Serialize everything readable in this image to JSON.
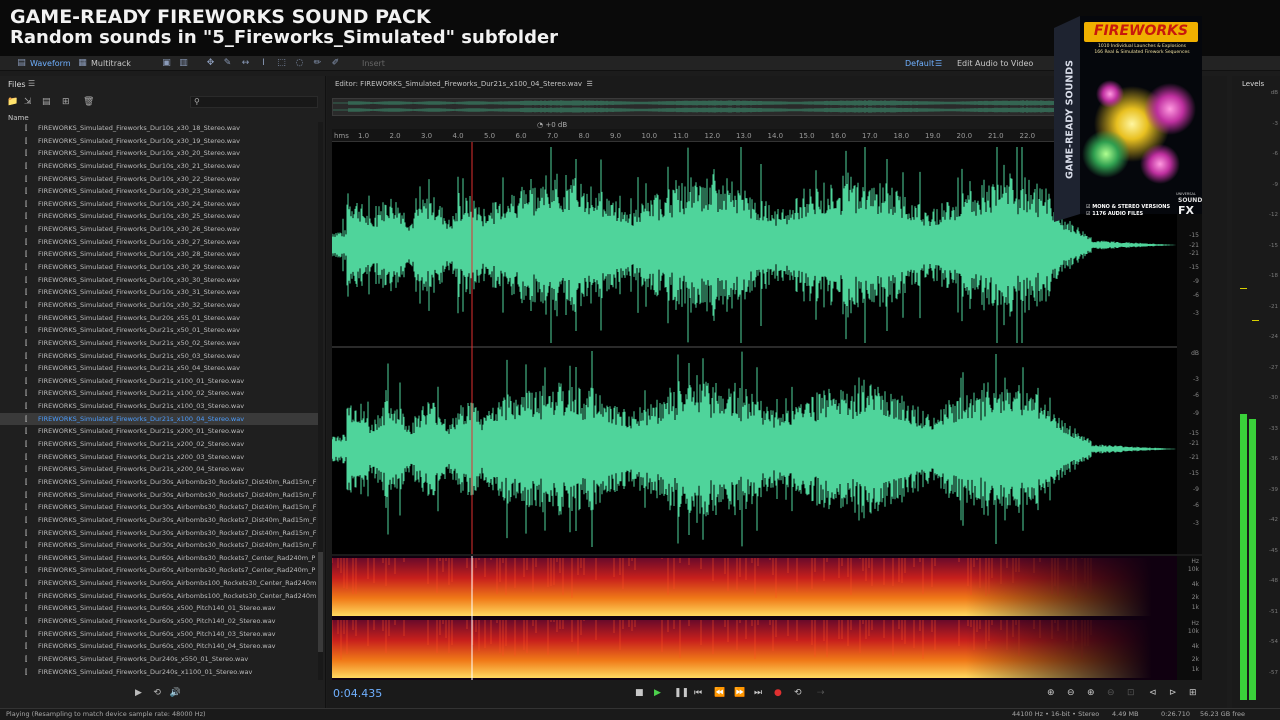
{
  "banner": {
    "line1": "GAME-READY FIREWORKS SOUND PACK",
    "line2": "Random sounds in \"5_Fireworks_Simulated\" subfolder"
  },
  "toolbar": {
    "waveform": "Waveform",
    "multitrack": "Multitrack",
    "insert": "Insert",
    "workspace": "Default",
    "edit_video": "Edit Audio to Video"
  },
  "files_panel": {
    "title": "Files",
    "column_name": "Name",
    "items": [
      "FIREWORKS_Simulated_Fireworks_Dur10s_x30_18_Stereo.wav",
      "FIREWORKS_Simulated_Fireworks_Dur10s_x30_19_Stereo.wav",
      "FIREWORKS_Simulated_Fireworks_Dur10s_x30_20_Stereo.wav",
      "FIREWORKS_Simulated_Fireworks_Dur10s_x30_21_Stereo.wav",
      "FIREWORKS_Simulated_Fireworks_Dur10s_x30_22_Stereo.wav",
      "FIREWORKS_Simulated_Fireworks_Dur10s_x30_23_Stereo.wav",
      "FIREWORKS_Simulated_Fireworks_Dur10s_x30_24_Stereo.wav",
      "FIREWORKS_Simulated_Fireworks_Dur10s_x30_25_Stereo.wav",
      "FIREWORKS_Simulated_Fireworks_Dur10s_x30_26_Stereo.wav",
      "FIREWORKS_Simulated_Fireworks_Dur10s_x30_27_Stereo.wav",
      "FIREWORKS_Simulated_Fireworks_Dur10s_x30_28_Stereo.wav",
      "FIREWORKS_Simulated_Fireworks_Dur10s_x30_29_Stereo.wav",
      "FIREWORKS_Simulated_Fireworks_Dur10s_x30_30_Stereo.wav",
      "FIREWORKS_Simulated_Fireworks_Dur10s_x30_31_Stereo.wav",
      "FIREWORKS_Simulated_Fireworks_Dur10s_x30_32_Stereo.wav",
      "FIREWORKS_Simulated_Fireworks_Dur20s_x55_01_Stereo.wav",
      "FIREWORKS_Simulated_Fireworks_Dur21s_x50_01_Stereo.wav",
      "FIREWORKS_Simulated_Fireworks_Dur21s_x50_02_Stereo.wav",
      "FIREWORKS_Simulated_Fireworks_Dur21s_x50_03_Stereo.wav",
      "FIREWORKS_Simulated_Fireworks_Dur21s_x50_04_Stereo.wav",
      "FIREWORKS_Simulated_Fireworks_Dur21s_x100_01_Stereo.wav",
      "FIREWORKS_Simulated_Fireworks_Dur21s_x100_02_Stereo.wav",
      "FIREWORKS_Simulated_Fireworks_Dur21s_x100_03_Stereo.wav",
      "FIREWORKS_Simulated_Fireworks_Dur21s_x100_04_Stereo.wav",
      "FIREWORKS_Simulated_Fireworks_Dur21s_x200_01_Stereo.wav",
      "FIREWORKS_Simulated_Fireworks_Dur21s_x200_02_Stereo.wav",
      "FIREWORKS_Simulated_Fireworks_Dur21s_x200_03_Stereo.wav",
      "FIREWORKS_Simulated_Fireworks_Dur21s_x200_04_Stereo.wav",
      "FIREWORKS_Simulated_Fireworks_Dur30s_Airbombs30_Rockets7_Dist40m_Rad15m_F",
      "FIREWORKS_Simulated_Fireworks_Dur30s_Airbombs30_Rockets7_Dist40m_Rad15m_F",
      "FIREWORKS_Simulated_Fireworks_Dur30s_Airbombs30_Rockets7_Dist40m_Rad15m_F",
      "FIREWORKS_Simulated_Fireworks_Dur30s_Airbombs30_Rockets7_Dist40m_Rad15m_F",
      "FIREWORKS_Simulated_Fireworks_Dur30s_Airbombs30_Rockets7_Dist40m_Rad15m_F",
      "FIREWORKS_Simulated_Fireworks_Dur30s_Airbombs30_Rockets7_Dist40m_Rad15m_F",
      "FIREWORKS_Simulated_Fireworks_Dur60s_Airbombs30_Rockets7_Center_Rad240m_P",
      "FIREWORKS_Simulated_Fireworks_Dur60s_Airbombs30_Rockets7_Center_Rad240m_P",
      "FIREWORKS_Simulated_Fireworks_Dur60s_Airbombs100_Rockets30_Center_Rad240m",
      "FIREWORKS_Simulated_Fireworks_Dur60s_Airbombs100_Rockets30_Center_Rad240m",
      "FIREWORKS_Simulated_Fireworks_Dur60s_x500_Pitch140_01_Stereo.wav",
      "FIREWORKS_Simulated_Fireworks_Dur60s_x500_Pitch140_02_Stereo.wav",
      "FIREWORKS_Simulated_Fireworks_Dur60s_x500_Pitch140_03_Stereo.wav",
      "FIREWORKS_Simulated_Fireworks_Dur60s_x500_Pitch140_04_Stereo.wav",
      "FIREWORKS_Simulated_Fireworks_Dur240s_x550_01_Stereo.wav",
      "FIREWORKS_Simulated_Fireworks_Dur240s_x1100_01_Stereo.wav"
    ],
    "selected_index": 23
  },
  "editor": {
    "title": "Editor: FIREWORKS_Simulated_Fireworks_Dur21s_x100_04_Stereo.wav",
    "gain": "+0 dB",
    "time": "0:04.435",
    "ruler_unit": "hms",
    "ruler_ticks": [
      "1.0",
      "2.0",
      "3.0",
      "4.0",
      "5.0",
      "6.0",
      "7.0",
      "8.0",
      "9.0",
      "10.0",
      "11.0",
      "12.0",
      "13.0",
      "14.0",
      "15.0",
      "16.0",
      "17.0",
      "18.0",
      "19.0",
      "20.0",
      "21.0",
      "22.0"
    ],
    "db_ticks_top": [
      "-3",
      "-6",
      "-9",
      "-15",
      "-21",
      "-21",
      "-15",
      "-9",
      "-6",
      "-3"
    ],
    "db_label": "dB",
    "db_ticks_bottom": [
      "-3",
      "-6",
      "-9",
      "-15",
      "-21",
      "-21",
      "-15",
      "-9",
      "-6",
      "-3"
    ],
    "hz_label": "Hz",
    "hz_ticks": [
      "10k",
      "4k",
      "2k",
      "1k"
    ],
    "colors": {
      "wave": "#4fd49b",
      "playhead": "#e03030",
      "accent": "#4b9dff"
    }
  },
  "levels": {
    "title": "Levels",
    "ticks": [
      "dB",
      "-3",
      "-6",
      "-9",
      "-12",
      "-15",
      "-18",
      "-21",
      "-24",
      "-27",
      "-30",
      "-33",
      "-36",
      "-39",
      "-42",
      "-45",
      "-48",
      "-51",
      "-54",
      "-57"
    ]
  },
  "status": {
    "left": "Playing (Resampling to match device sample rate: 48000 Hz)",
    "format": "44100 Hz • 16-bit • Stereo",
    "size": "4.49 MB",
    "duration": "0:26.710",
    "free": "56.23 GB free"
  },
  "product": {
    "brand": "FIREWORKS",
    "line1": "1010 Individual Launches & Explosions",
    "line2": "166 Real & Simulated Firework Sequences",
    "side": "GAME-READY SOUNDS",
    "check1": "MONO & STEREO VERSIONS",
    "check2": "1176 AUDIO FILES",
    "logo_top": "UNIVERSAL",
    "logo_mid": "SOUND",
    "logo_bot": "FX"
  }
}
